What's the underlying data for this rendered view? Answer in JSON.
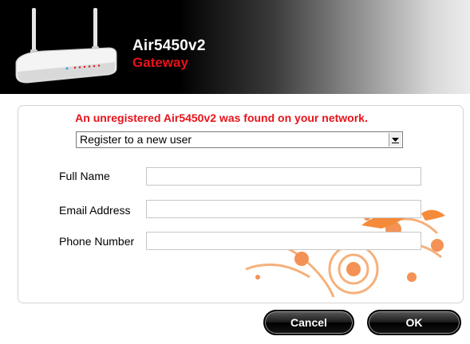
{
  "header": {
    "product_name": "Air5450v2",
    "product_type": "Gateway",
    "image": "router-image",
    "brand_color": "#e8121b"
  },
  "form": {
    "warning": "An unregistered Air5450v2 was found on your network.",
    "select_value": "Register to a new user",
    "select_icon": "chevron-down-icon",
    "fields": {
      "full_name": {
        "label": "Full Name",
        "value": ""
      },
      "email": {
        "label": "Email Address",
        "value": ""
      },
      "phone": {
        "label": "Phone Number",
        "value": ""
      }
    }
  },
  "buttons": {
    "cancel": "Cancel",
    "ok": "OK"
  }
}
